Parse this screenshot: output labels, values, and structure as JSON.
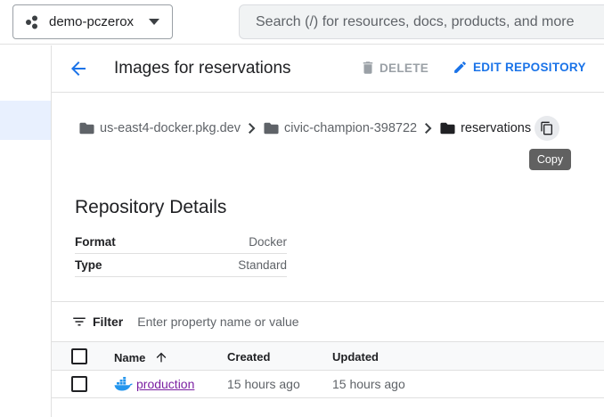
{
  "topbar": {
    "project_name": "demo-pczerox",
    "search_placeholder": "Search (/) for resources, docs, products, and more"
  },
  "header": {
    "title": "Images for reservations",
    "delete_label": "DELETE",
    "edit_label": "EDIT REPOSITORY"
  },
  "breadcrumb": {
    "items": [
      "us-east4-docker.pkg.dev",
      "civic-champion-398722",
      "reservations"
    ],
    "copy_tooltip": "Copy"
  },
  "details": {
    "title": "Repository Details",
    "rows": [
      {
        "key": "Format",
        "value": "Docker"
      },
      {
        "key": "Type",
        "value": "Standard"
      }
    ]
  },
  "filter": {
    "label": "Filter",
    "placeholder": "Enter property name or value"
  },
  "table": {
    "columns": [
      "Name",
      "Created",
      "Updated"
    ],
    "rows": [
      {
        "name": "production",
        "created": "15 hours ago",
        "updated": "15 hours ago"
      }
    ]
  },
  "colors": {
    "accent": "#1a73e8",
    "visited_link": "#7b1fa2",
    "docker_blue": "#2496ed"
  }
}
